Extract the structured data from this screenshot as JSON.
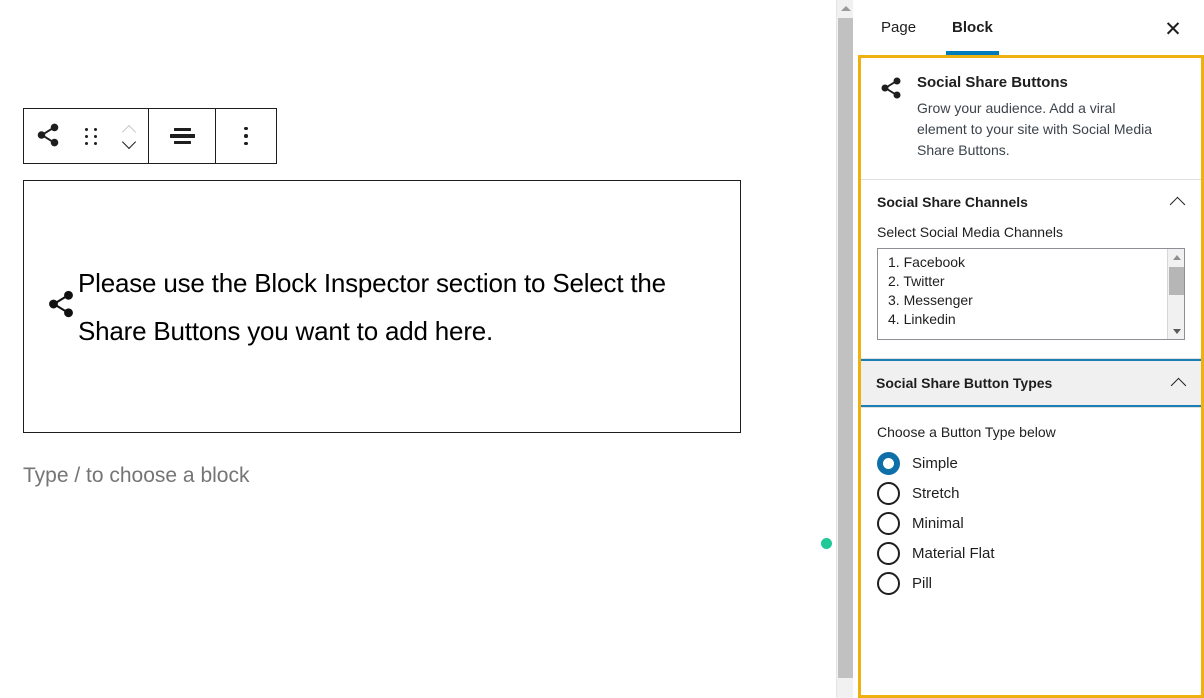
{
  "editor": {
    "toolbar": {
      "share_icon": "share-icon",
      "drag_icon": "drag-handle-icon",
      "move_up_icon": "chevron-up-icon",
      "move_down_icon": "chevron-down-icon",
      "align_icon": "align-center-icon",
      "more_icon": "more-options-icon"
    },
    "block": {
      "icon": "share-icon",
      "text": "Please use the Block Inspector section to Select the Share Buttons you want to add here."
    },
    "placeholder": "Type / to choose a block"
  },
  "sidebar": {
    "tabs": [
      {
        "label": "Page",
        "active": false
      },
      {
        "label": "Block",
        "active": true
      }
    ],
    "close_label": "✕",
    "block_card": {
      "icon": "share-icon",
      "title": "Social Share Buttons",
      "description": "Grow your audience. Add a viral element to your site with Social Media Share Buttons."
    },
    "panels": [
      {
        "title": "Social Share Channels",
        "expanded": true,
        "collapse_icon": "chevron-up-icon",
        "field_label": "Select Social Media Channels",
        "options": [
          "1. Facebook",
          "2. Twitter",
          "3. Messenger",
          "4. Linkedin"
        ]
      },
      {
        "title": "Social Share Button Types",
        "expanded": true,
        "focused": true,
        "collapse_icon": "chevron-up-icon",
        "field_label": "Choose a Button Type below",
        "radios": [
          {
            "label": "Simple",
            "checked": true
          },
          {
            "label": "Stretch",
            "checked": false
          },
          {
            "label": "Minimal",
            "checked": false
          },
          {
            "label": "Material Flat",
            "checked": false
          },
          {
            "label": "Pill",
            "checked": false
          }
        ]
      }
    ]
  },
  "scrollbar": {
    "up_arrow_icon": "scroll-up-arrow-icon"
  },
  "colors": {
    "highlight_border": "#eeb111",
    "focus_border": "#1b7fb5",
    "tab_active": "#007cba",
    "radio_checked": "#0f6fa8",
    "caret_dot": "#20c997"
  }
}
